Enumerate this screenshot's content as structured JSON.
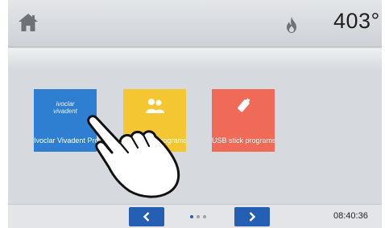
{
  "header": {
    "home_icon": "home-icon",
    "flame_icon": "flame-icon",
    "temperature": "403°"
  },
  "tiles": [
    {
      "logo_line1": "ivoclar",
      "logo_line2": "vivadent",
      "label": "Ivoclar Vivadent Programs",
      "color": "#2e7fd1"
    },
    {
      "label": "Individual Programs",
      "color": "#f3c632",
      "icon": "people-icon"
    },
    {
      "label": "USB stick programs",
      "color": "#f06b57",
      "icon": "usb-stick-icon"
    }
  ],
  "footer": {
    "prev_icon": "chevron-left-icon",
    "next_icon": "chevron-right-icon",
    "page_count": 3,
    "current_page": 1,
    "time": "08:40:36"
  },
  "overlay": {
    "icon": "pointing-hand-icon"
  },
  "colors": {
    "accent": "#245fb3"
  }
}
